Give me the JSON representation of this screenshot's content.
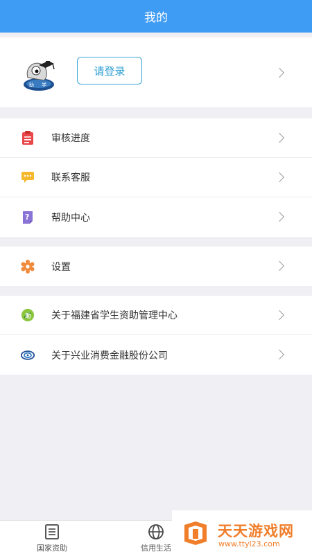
{
  "header": {
    "title": "我的"
  },
  "profile": {
    "login_label": "请登录"
  },
  "menu_group1": [
    {
      "label": "审核进度",
      "icon": "clipboard-icon"
    },
    {
      "label": "联系客服",
      "icon": "chat-icon"
    },
    {
      "label": "帮助中心",
      "icon": "help-icon"
    }
  ],
  "menu_group2": [
    {
      "label": "设置",
      "icon": "gear-icon"
    }
  ],
  "menu_group3": [
    {
      "label": "关于福建省学生资助管理中心",
      "icon": "fujian-center-icon"
    },
    {
      "label": "关于兴业消费金融股份公司",
      "icon": "cib-finance-icon"
    }
  ],
  "tabbar": {
    "tabs": [
      {
        "label": "国家资助",
        "icon": "document-icon"
      },
      {
        "label": "信用生活",
        "icon": "globe-icon"
      }
    ]
  },
  "watermark": {
    "title": "天天游戏网",
    "url": "www.ttyl23.com"
  },
  "colors": {
    "header": "#3f9cf4",
    "login_border": "#3aa5d8",
    "background": "#efeff4",
    "watermark": "#f07e2a"
  }
}
